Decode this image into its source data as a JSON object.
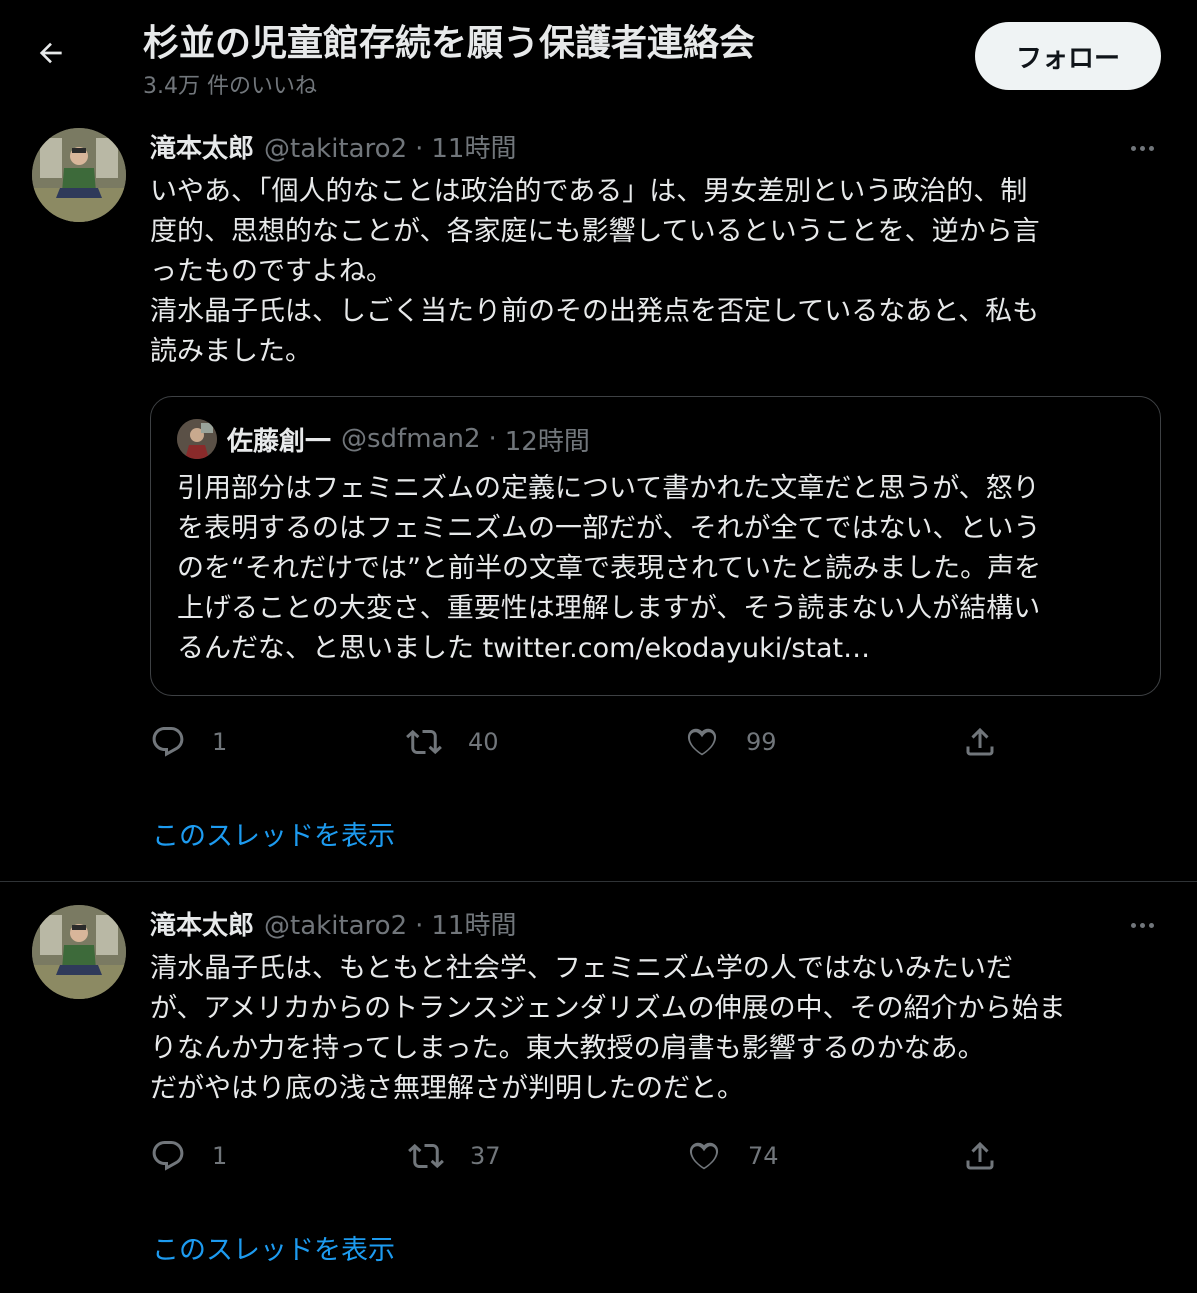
{
  "header": {
    "title": "杉並の児童館存続を願う保護者連絡会",
    "subtitle": "3.4万 件のいいね",
    "follow_label": "フォロー"
  },
  "tweets": [
    {
      "author": "滝本太郎",
      "handle": "@takitaro2",
      "dot": "·",
      "time": "11時間",
      "lines": [
        "いやあ、「個人的なことは政治的である」は、男女差別という政治的、制",
        "度的、思想的なことが、各家庭にも影響しているということを、逆から言",
        "ったものですよね。",
        "清水晶子氏は、しごく当たり前のその出発点を否定しているなあと、私も",
        "読みました。"
      ],
      "quote": {
        "author": "佐藤創一",
        "handle": "@sdfman2",
        "dot": "·",
        "time": "12時間",
        "lines": [
          "引用部分はフェミニズムの定義について書かれた文章だと思うが、怒り",
          "を表明するのはフェミニズムの一部だが、それが全てではない、という",
          "のを“それだけでは”と前半の文章で表現されていたと読みました。声を",
          "上げることの大変さ、重要性は理解しますが、そう読まない人が結構い",
          "るんだな、と思いました twitter.com/ekodayuki/stat…"
        ]
      },
      "replies": "1",
      "retweets": "40",
      "likes": "99",
      "thread_link": "このスレッドを表示"
    },
    {
      "author": "滝本太郎",
      "handle": "@takitaro2",
      "dot": "·",
      "time": "11時間",
      "lines": [
        "清水晶子氏は、もともと社会学、フェミニズム学の人ではないみたいだ",
        "が、アメリカからのトランスジェンダリズムの伸展の中、その紹介から始ま",
        "りなんか力を持ってしまった。東大教授の肩書も影響するのかなあ。",
        "だがやはり底の浅さ無理解さが判明したのだと。"
      ],
      "replies": "1",
      "retweets": "37",
      "likes": "74",
      "thread_link": "このスレッドを表示"
    }
  ],
  "icons": {
    "back": "back-arrow-icon",
    "more": "more-dots-icon",
    "reply": "reply-icon",
    "retweet": "retweet-icon",
    "like": "heart-icon",
    "share": "share-icon"
  },
  "colors": {
    "background": "#000000",
    "text": "#e7e9ea",
    "muted": "#71767b",
    "link": "#1d9bf0",
    "follow_bg": "#eff3f4"
  }
}
